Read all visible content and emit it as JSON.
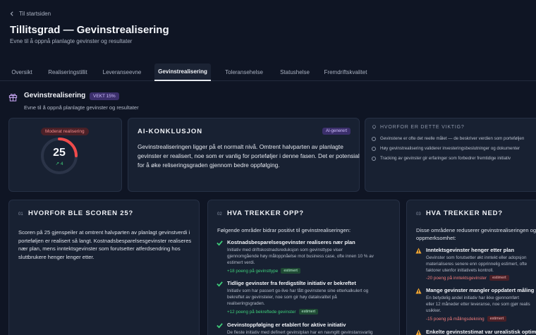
{
  "nav": {
    "back_label": "Til startsiden"
  },
  "page": {
    "title": "Tillitsgrad — Gevinstrealisering",
    "subtitle": "Evne til å oppnå planlagte gevinster og resultater"
  },
  "tabs": [
    {
      "label": "Oversikt"
    },
    {
      "label": "Realiseringstillit"
    },
    {
      "label": "Leveranseevne"
    },
    {
      "label": "Gevinstrealisering"
    },
    {
      "label": "Toleransehelse"
    },
    {
      "label": "Statushelse"
    },
    {
      "label": "Fremdriftskvalitet"
    }
  ],
  "section": {
    "title": "Gevinstrealisering",
    "weight_badge": "VEKT 15%",
    "subtitle": "Evne til å oppnå planlagte gevinster og resultater"
  },
  "score_card": {
    "status_label": "Moderat realisering",
    "score": "25",
    "trend": "↗ 4",
    "gauge_fraction": 0.25
  },
  "ai": {
    "title": "AI-KONKLUSJON",
    "badge": "AI-generert",
    "text": "Gevinstrealiseringen ligger på et normalt nivå. Omtrent halvparten av planlagte gevinster er realisert, noe som er vanlig for porteføljer i denne fasen. Det er potensial for å øke reliseringsgraden gjennom bedre oppfølging."
  },
  "why": {
    "title": "HVORFOR ER DETTE VIKTIG?",
    "items": [
      "Gevinstene er ofte det reelle målet — de beskriver verdien som porteføljen",
      "Høy gevinstrealisering validerer investeringsbeslutninger og dokumenter",
      "Tracking av gevinster gir erfaringer som forbedrer fremtidige initiativ"
    ]
  },
  "col1": {
    "num": "01",
    "title": "HVORFOR BLE SCOREN 25?",
    "text": "Scoren på 25 gjenspeiler at omtrent halvparten av planlagt gevinstverdi i porteføljen er realisert så langt. Kostnadsbesparelsesgevinster realiseres nær plan, mens inntektsgevinster som forutsetter atferdsendring hos sluttbrukere henger lenger etter."
  },
  "col2": {
    "num": "02",
    "title": "HVA TREKKER OPP?",
    "intro": "Følgende områder bidrar positivt til gevinstrealiseringen:",
    "items": [
      {
        "title": "Kostnadsbesparelsesgevinster realiseres nær plan",
        "desc1": "Initiativ med driftskostnadsreduksjon som gevinsttype viser",
        "desc2": "gjennomgående høy måloppnåelse mot business case, ofte innen 10 % av",
        "desc3": "estimert verdi.",
        "points": "+18 poeng på gevinsttype",
        "tag": "estimert"
      },
      {
        "title": "Tidlige gevinster fra ferdigstilte initiativ er bekreftet",
        "desc1": "Initiativ som har passert go-live har fått gevinstene sine etterkalkulert og",
        "desc2": "bekreftet av gevinsteier, noe som gir høy datakvalitet på",
        "desc3": "realiseringsgraden.",
        "points": "+12 poeng på bekreftede gevinster",
        "tag": "estimert"
      },
      {
        "title": "Gevinstoppfølging er etablert for aktive initiativ",
        "desc1": "De fleste initiativ med definert gevinstplan har en navngitt gevinstansvarlig"
      }
    ]
  },
  "col3": {
    "num": "03",
    "title": "HVA TREKKER NED?",
    "intro1": "Disse områdene reduserer gevinstrealiseringen og krever",
    "intro2": "oppmerksomhet:",
    "items": [
      {
        "title": "Inntektsgevinster henger etter plan",
        "desc1": "Gevinster som forutsetter økt inntekt eller adopsjon",
        "desc2": "materialiseres senere enn opprinnelig estimert, ofte",
        "desc3": "faktorer utenfor initiativets kontroll.",
        "points": "-20 poeng på inntektsgevinster",
        "tag": "estimert"
      },
      {
        "title": "Mange gevinster mangler oppdatert måling",
        "desc1": "En betydelig andel initiativ har ikke gjennomført",
        "desc2": "eller 12 måneder etter leveranse, noe som gjør realis",
        "desc3": "usikker.",
        "points": "-15 poeng på målingsdekning",
        "tag": "estimert"
      },
      {
        "title": "Enkelte gevinstestimat var urealistisk optimis"
      }
    ]
  }
}
